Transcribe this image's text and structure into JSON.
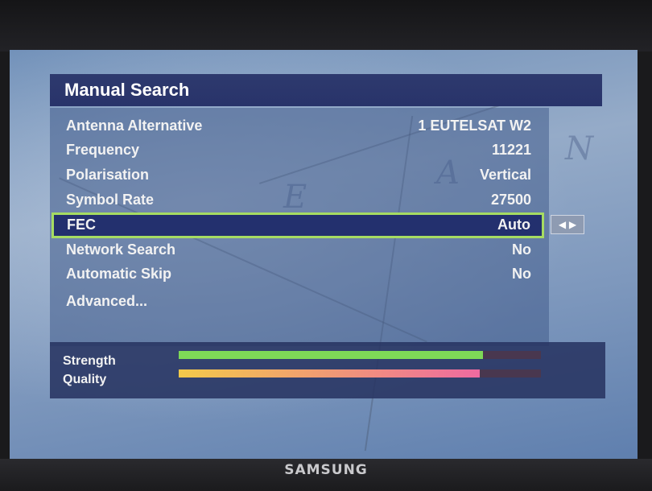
{
  "device": {
    "brand": "SAMSUNG"
  },
  "menu": {
    "title": "Manual Search",
    "items": [
      {
        "label": "Antenna Alternative",
        "value": "1 EUTELSAT W2"
      },
      {
        "label": "Frequency",
        "value": "11221"
      },
      {
        "label": "Polarisation",
        "value": "Vertical"
      },
      {
        "label": "Symbol Rate",
        "value": "27500"
      },
      {
        "label": "FEC",
        "value": "Auto",
        "selected": true
      },
      {
        "label": "Network Search",
        "value": "No"
      },
      {
        "label": "Automatic Skip",
        "value": "No"
      },
      {
        "label": "Advanced...",
        "value": ""
      }
    ],
    "selector_arrows": "◀ ▶"
  },
  "signal": {
    "strength": {
      "label": "Strength",
      "level": 0.84
    },
    "quality": {
      "label": "Quality",
      "level": 0.83
    }
  },
  "colors": {
    "highlight_border": "#a6dc62",
    "title_bar": "#2e3a6e",
    "strength_bar": "#7ed957",
    "quality_bar_start": "#f3c94a",
    "quality_bar_end": "#ee6aa0"
  }
}
